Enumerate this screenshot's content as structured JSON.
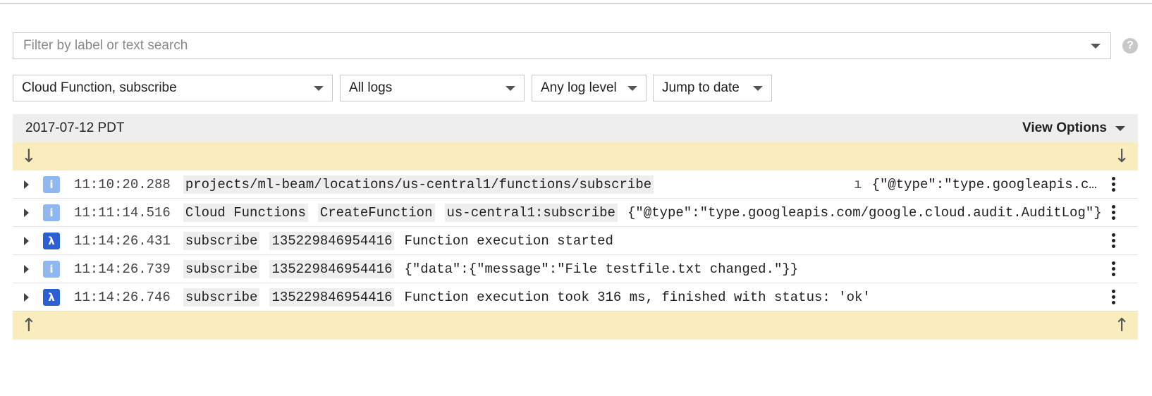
{
  "filter": {
    "placeholder": "Filter by label or text search"
  },
  "help": {
    "label": "?"
  },
  "dropdowns": {
    "resource": "Cloud Function, subscribe",
    "logs": "All logs",
    "level": "Any log level",
    "date": "Jump to date"
  },
  "panel": {
    "date": "2017-07-12 PDT",
    "view_options": "View Options",
    "load_newer_icon": "arrow-down-icon",
    "load_older_icon": "arrow-up-icon",
    "arrow_down": "↓",
    "arrow_up": "↑"
  },
  "rows": [
    {
      "severity": "info",
      "severity_glyph": "i",
      "time": "11:10:20.288",
      "chips": [
        "projects/ml-beam/locations/us-central1/functions/subscribe"
      ],
      "marker": "ı",
      "message": "{\"@type\":\"type.googleapis.com/google.cloud.audit.AuditLog\"}"
    },
    {
      "severity": "info",
      "severity_glyph": "i",
      "time": "11:11:14.516",
      "chips": [
        "Cloud Functions",
        "CreateFunction",
        "us-central1:subscribe"
      ],
      "message": "{\"@type\":\"type.googleapis.com/google.cloud.audit.AuditLog\"}"
    },
    {
      "severity": "lambda",
      "severity_glyph": "λ",
      "time": "11:14:26.431",
      "chips": [
        "subscribe",
        "135229846954416"
      ],
      "message": "Function execution started"
    },
    {
      "severity": "info",
      "severity_glyph": "i",
      "time": "11:14:26.739",
      "chips": [
        "subscribe",
        "135229846954416"
      ],
      "message": "{\"data\":{\"message\":\"File testfile.txt changed.\"}}"
    },
    {
      "severity": "lambda",
      "severity_glyph": "λ",
      "time": "11:14:26.746",
      "chips": [
        "subscribe",
        "135229846954416"
      ],
      "message": "Function execution took 316 ms, finished with status: 'ok'"
    }
  ]
}
